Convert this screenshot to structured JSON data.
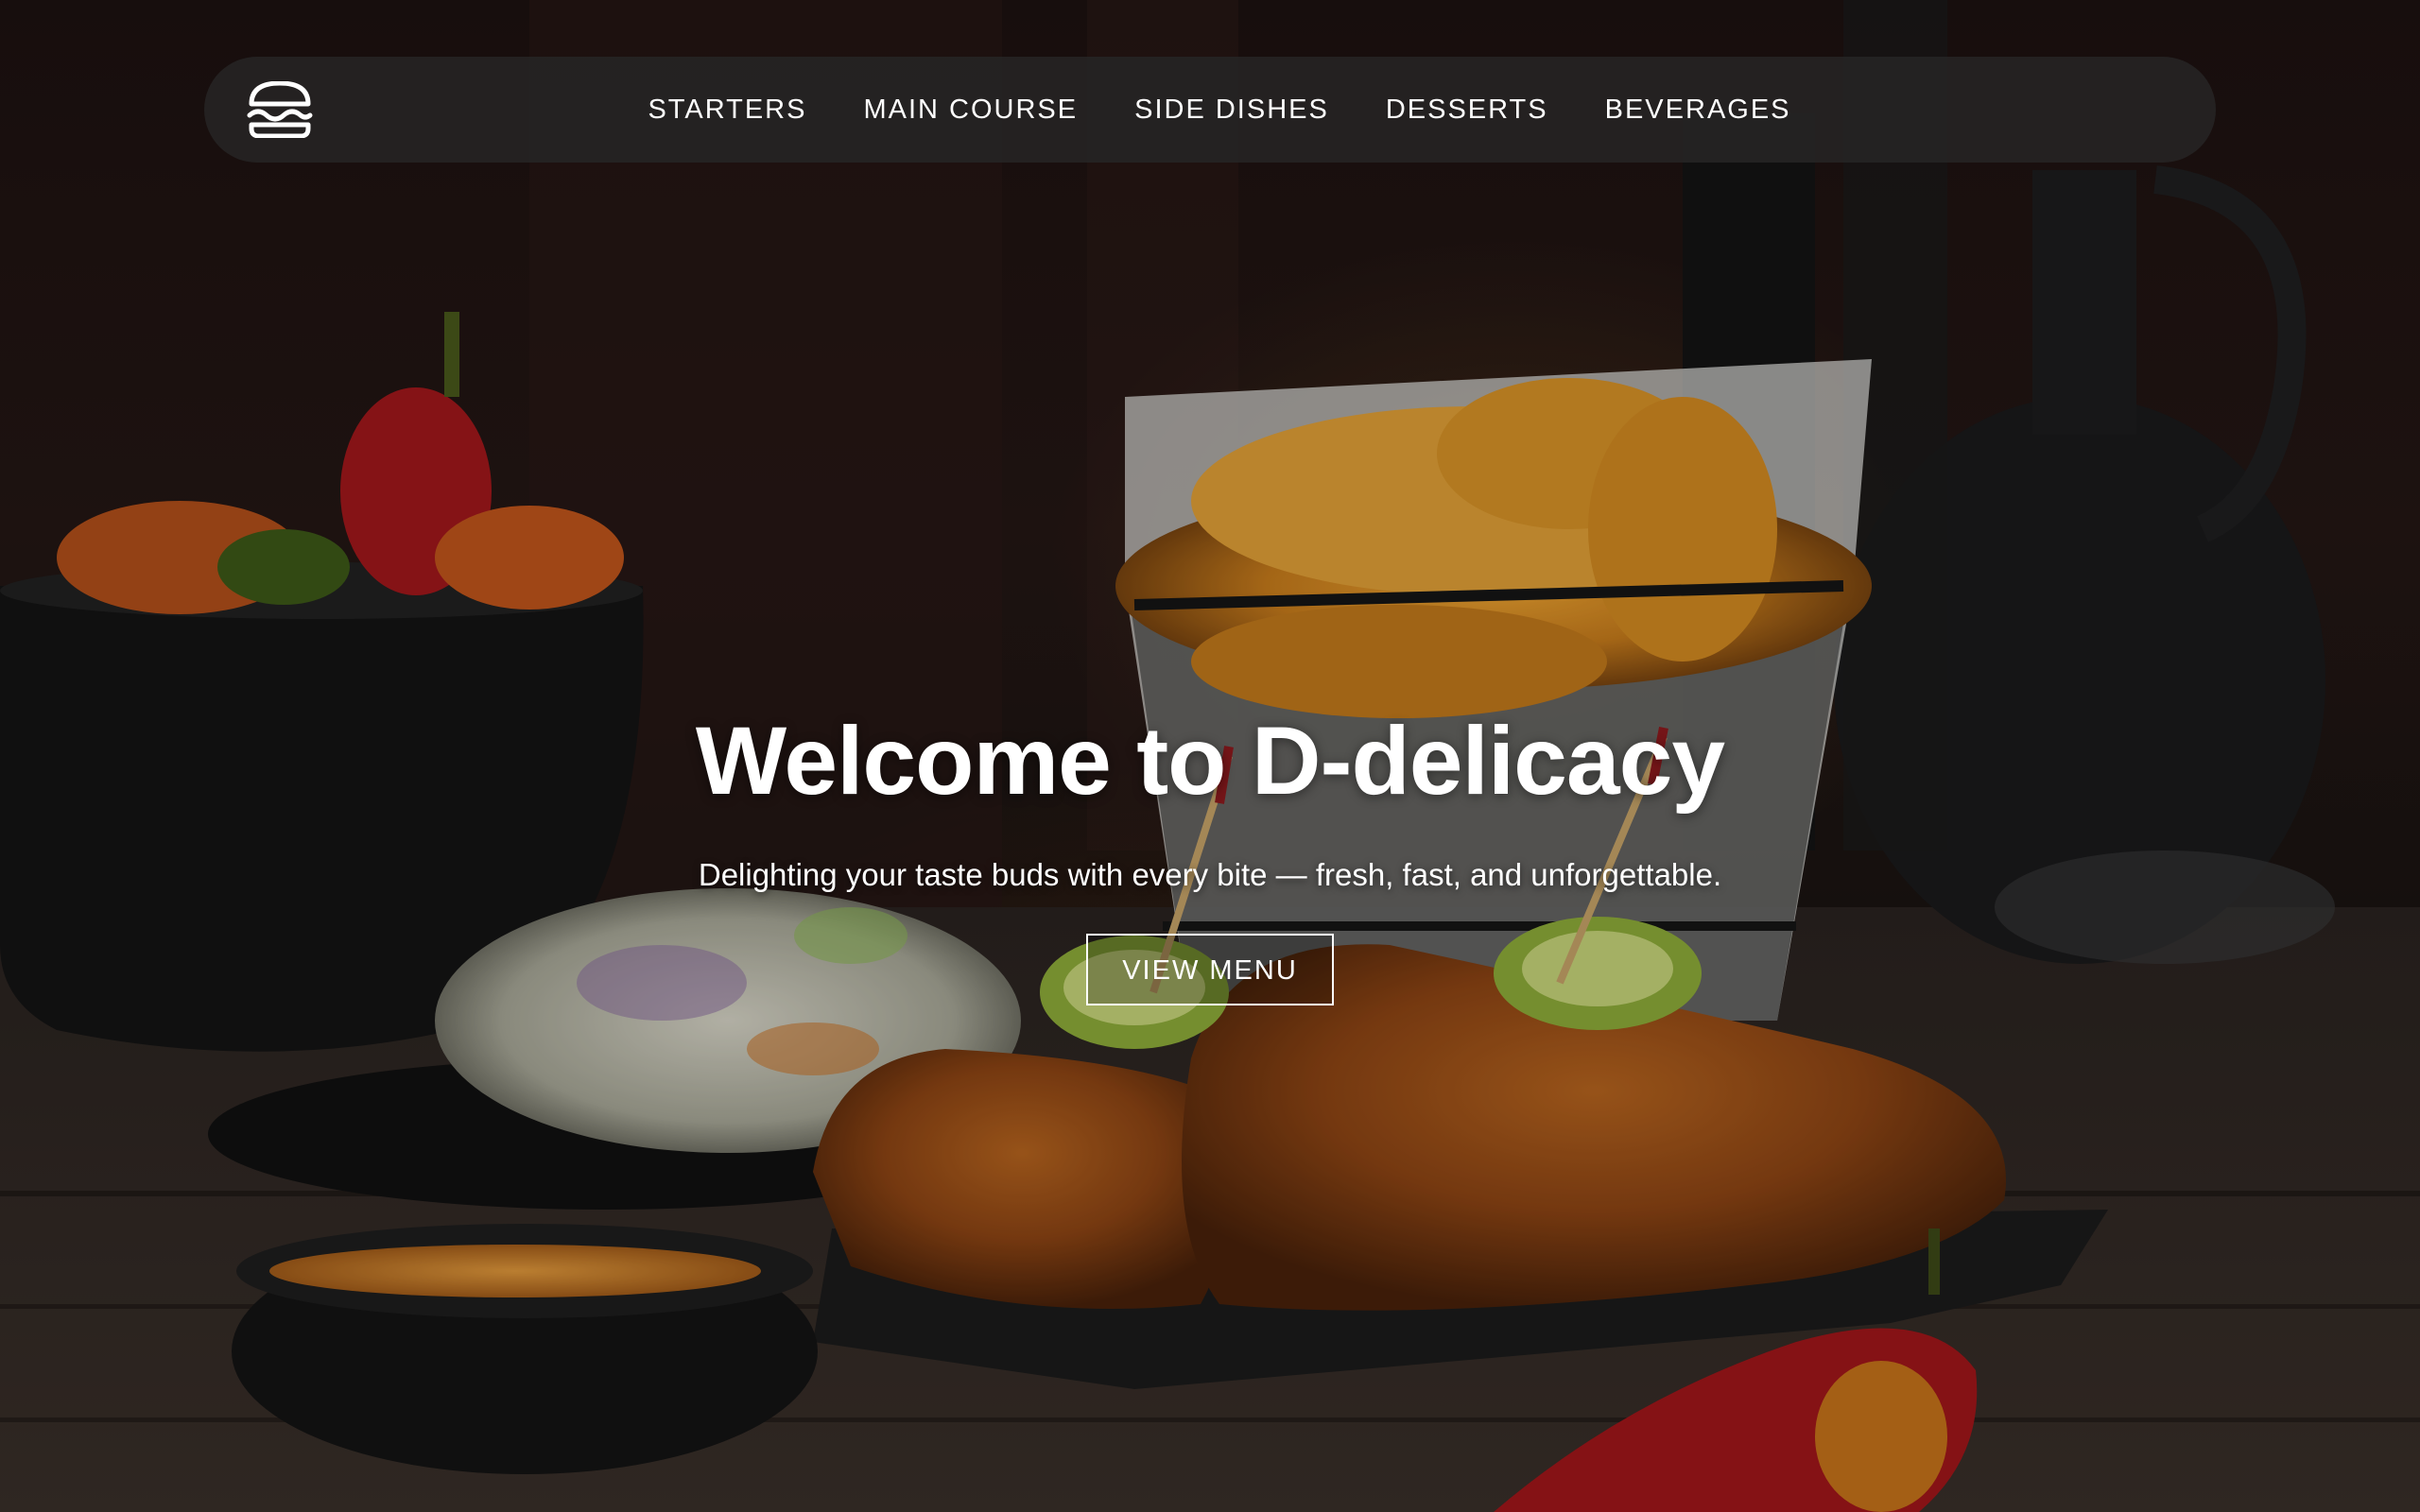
{
  "nav": {
    "logo_icon": "burger-icon",
    "links": [
      {
        "label": "STARTERS"
      },
      {
        "label": "MAIN COURSE"
      },
      {
        "label": "SIDE DISHES"
      },
      {
        "label": "DESSERTS"
      },
      {
        "label": "BEVERAGES"
      }
    ]
  },
  "hero": {
    "title": "Welcome to D-delicacy",
    "subtitle": "Delighting your taste buds with every bite — fresh, fast, and unforgettable.",
    "button_label": "VIEW MENU",
    "background_image": "fried-chicken-fries-coleslaw-photo"
  },
  "colors": {
    "navbar_bg": "#262424",
    "text": "#ffffff",
    "background": "#1d1211"
  }
}
